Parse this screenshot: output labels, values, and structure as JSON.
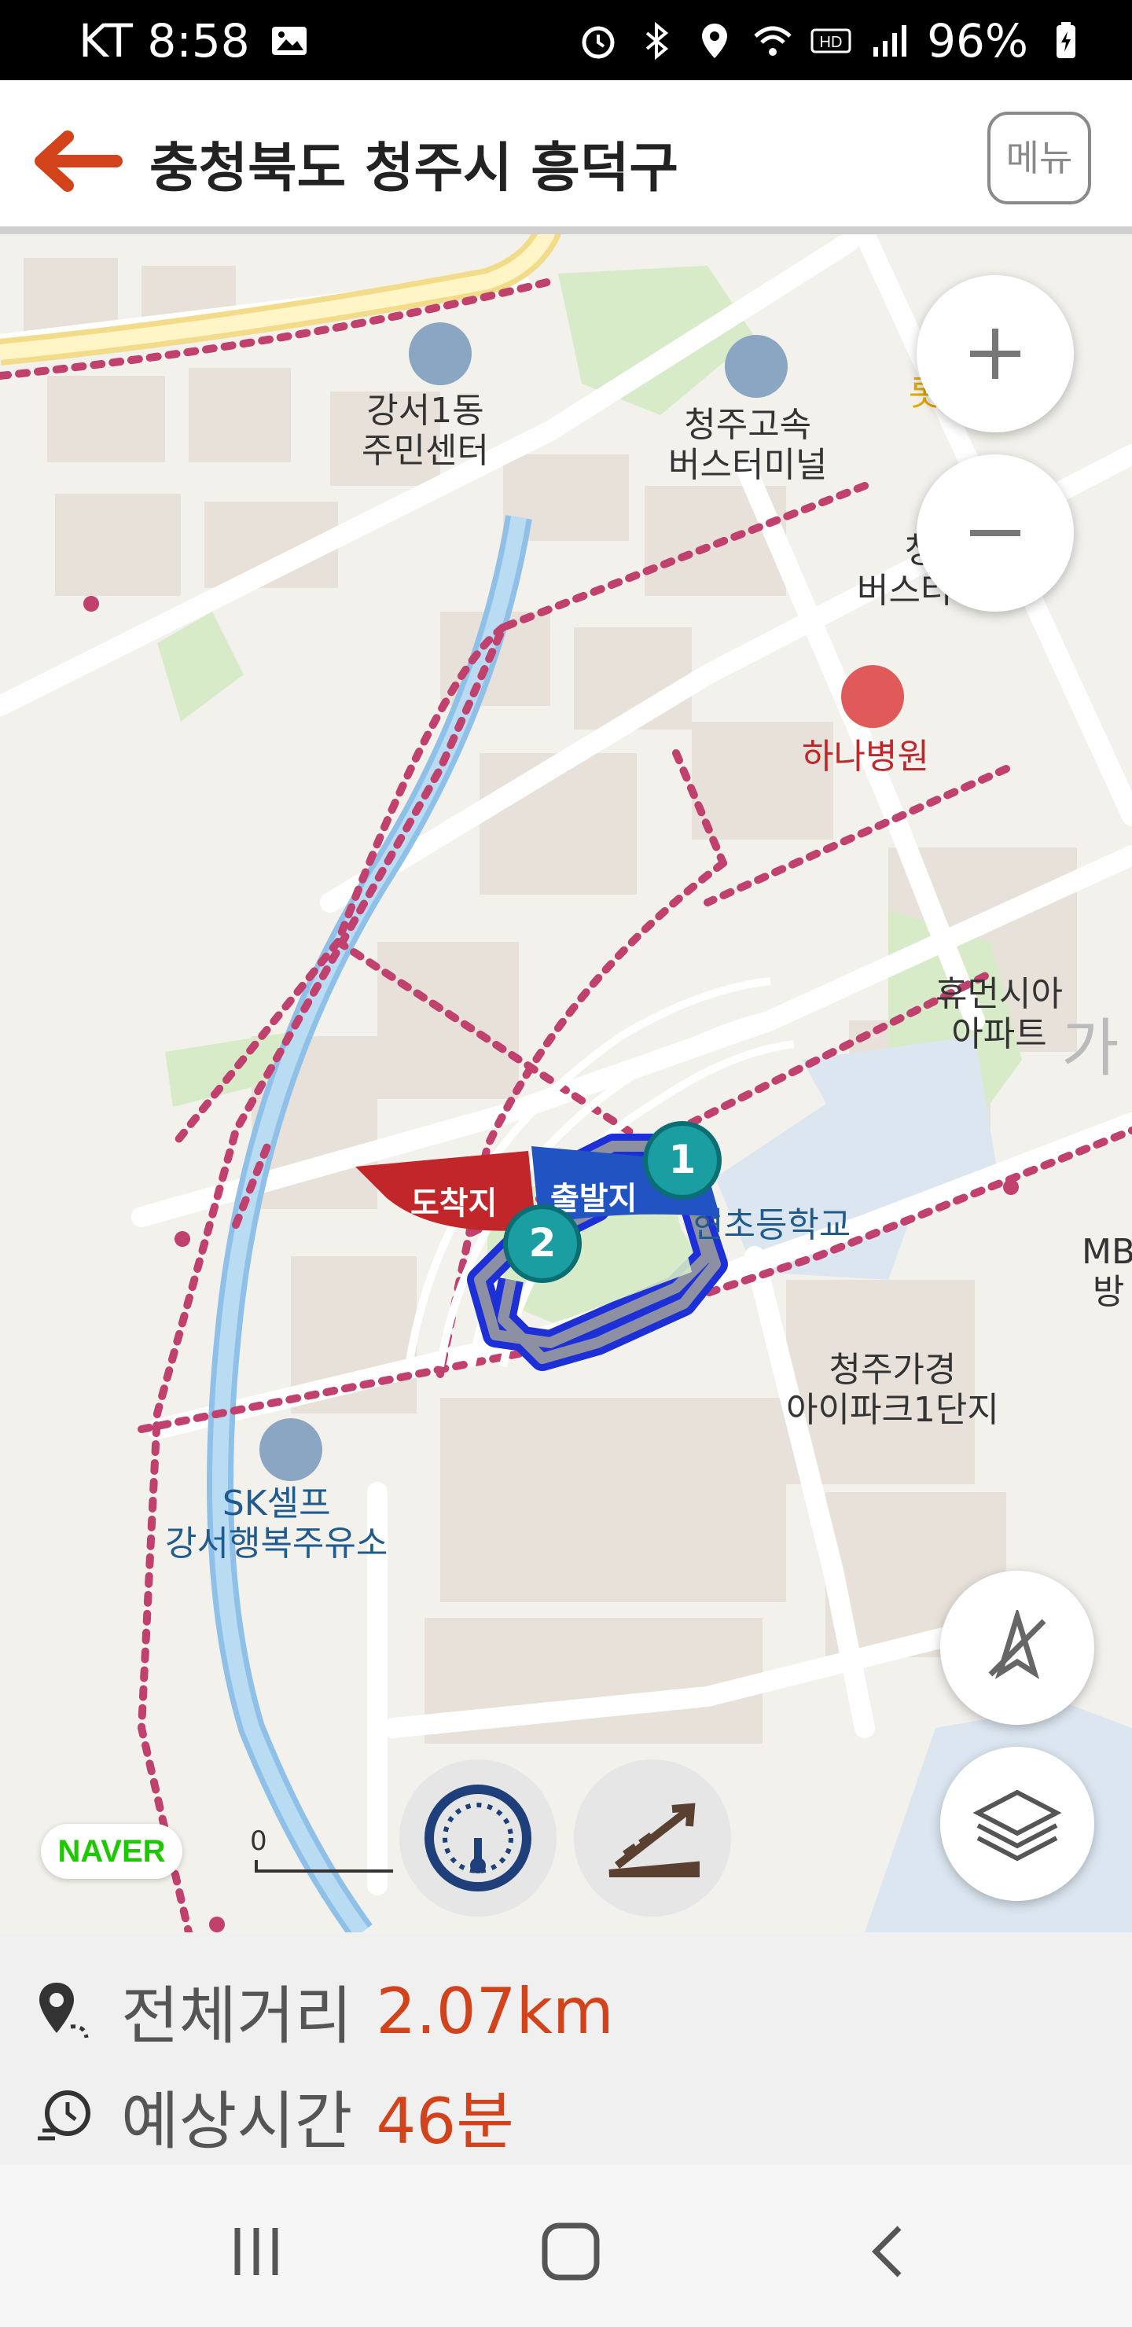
{
  "status_bar": {
    "carrier_time": "KT 8:58",
    "battery": "96%"
  },
  "header": {
    "title": "충청북도 청주시 흥덕구",
    "menu_label": "메뉴"
  },
  "map": {
    "pois": {
      "community_center": "강서1동\n주민센터",
      "bus_terminal": "청주고속\n버스터미널",
      "bus_terminal_2": "청주\n버스터미널",
      "hospital": "하나병원",
      "apartment_1": "휴먼시아\n아파트",
      "school": "현초등학교",
      "apartment_2": "청주가경\n아이파크1단지",
      "gas_station": "SK셀프\n강서행복주유소",
      "edge_text_1": "MB\n방",
      "edge_text_2": "가",
      "edge_text_3": "롯"
    },
    "flags": {
      "arrival": "도착지",
      "departure": "출발지"
    },
    "markers": [
      "1",
      "2"
    ],
    "naver_logo": "NAVER",
    "scale_zero": "0"
  },
  "route_info": {
    "distance_label": "전체거리",
    "distance_value": "2.07km",
    "time_label": "예상시간",
    "time_value": "46분"
  },
  "colors": {
    "accent": "#d2431b",
    "route": "#1d2fd6",
    "trail": "#c0406e"
  }
}
